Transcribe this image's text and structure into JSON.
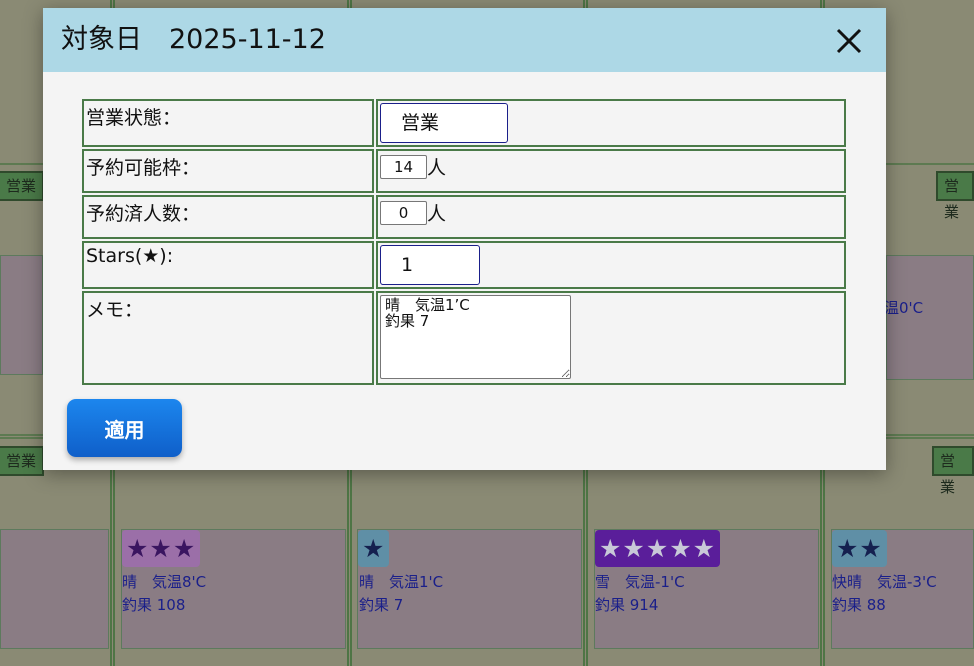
{
  "calendar": {
    "status_tags": [
      "営業",
      "営業",
      "営業",
      "営業"
    ],
    "partial_weather": "温0'C",
    "cells": [
      {
        "stars": "★★★",
        "weather": "晴　気温8'C",
        "catch": "釣果 108",
        "badge_color": "#9b6fa8",
        "star_color": "#3a1560"
      },
      {
        "stars": "★",
        "weather": "晴　気温1'C",
        "catch": "釣果 7",
        "badge_color": "#5f8fa6",
        "star_color": "#15204f"
      },
      {
        "stars": "★★★★★",
        "weather": "雪　気温-1'C",
        "catch": "釣果 914",
        "badge_color": "#5a1e9a",
        "star_color": "#c8c8d8"
      },
      {
        "stars": "★★",
        "weather": "快晴　気温-3'C",
        "catch": "釣果 88",
        "badge_color": "#5f8fa6",
        "star_color": "#15204f"
      }
    ]
  },
  "modal": {
    "title": "対象日　2025-11-12",
    "close_icon": "close-icon",
    "rows": {
      "status": {
        "label": "営業状態：",
        "value": "営業"
      },
      "capacity": {
        "label": "予約可能枠：",
        "value": "14",
        "unit": "人"
      },
      "booked": {
        "label": "予約済人数：",
        "value": "0",
        "unit": "人"
      },
      "stars": {
        "label": "Stars(★):",
        "value": "1"
      },
      "memo": {
        "label": "メモ：",
        "value": "晴　気温1’C\n釣果 7"
      }
    },
    "apply_label": "適用",
    "colors": {
      "header_bg": "#add8e6",
      "apply_button": "#1575e0",
      "table_border": "#4a7a48"
    }
  }
}
